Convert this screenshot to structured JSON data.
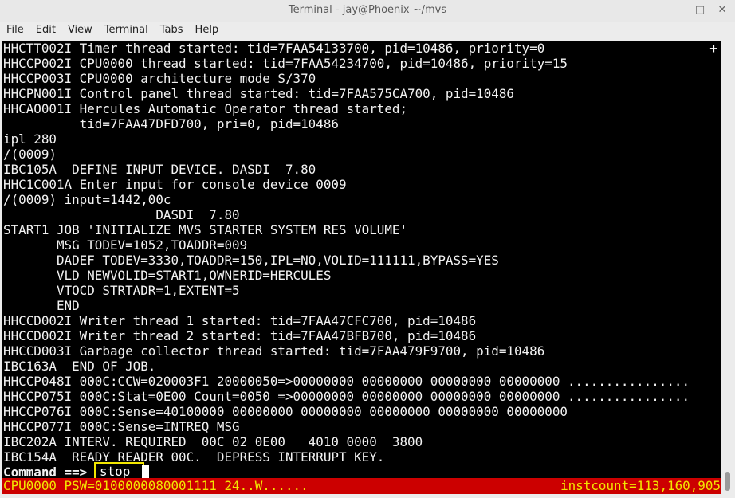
{
  "window": {
    "title": "Terminal - jay@Phoenix ~/mvs",
    "minimize_glyph": "–",
    "maximize_glyph": "□",
    "close_glyph": "✕"
  },
  "menubar": {
    "items": [
      "File",
      "Edit",
      "View",
      "Terminal",
      "Tabs",
      "Help"
    ]
  },
  "terminal": {
    "corner_marker": "+",
    "lines": [
      "HHCTT002I Timer thread started: tid=7FAA54133700, pid=10486, priority=0",
      "HHCCP002I CPU0000 thread started: tid=7FAA54234700, pid=10486, priority=15",
      "HHCCP003I CPU0000 architecture mode S/370",
      "HHCPN001I Control panel thread started: tid=7FAA575CA700, pid=10486",
      "HHCAO001I Hercules Automatic Operator thread started;",
      "          tid=7FAA47DFD700, pri=0, pid=10486",
      "ipl 280",
      "/(0009)",
      "IBC105A  DEFINE INPUT DEVICE. DASDI  7.80",
      "HHC1C001A Enter input for console device 0009",
      "/(0009) input=1442,00c",
      "                    DASDI  7.80",
      "START1 JOB 'INITIALIZE MVS STARTER SYSTEM RES VOLUME'",
      "       MSG TODEV=1052,TOADDR=009",
      "       DADEF TODEV=3330,TOADDR=150,IPL=NO,VOLID=111111,BYPASS=YES",
      "       VLD NEWVOLID=START1,OWNERID=HERCULES",
      "       VTOCD STRTADR=1,EXTENT=5",
      "       END",
      "HHCCD002I Writer thread 1 started: tid=7FAA47CFC700, pid=10486",
      "HHCCD002I Writer thread 2 started: tid=7FAA47BFB700, pid=10486",
      "HHCCD003I Garbage collector thread started: tid=7FAA479F9700, pid=10486",
      "IBC163A  END OF JOB.",
      "HHCCP048I 000C:CCW=020003F1 20000050=>00000000 00000000 00000000 00000000 ................",
      "HHCCP075I 000C:Stat=0E00 Count=0050 =>00000000 00000000 00000000 00000000 ................",
      "HHCCP076I 000C:Sense=40100000 00000000 00000000 00000000 00000000 00000000",
      "HHCCP077I 000C:Sense=INTREQ MSG",
      "IBC202A INTERV. REQUIRED  00C 02 0E00   4010 0000  3800",
      "IBC154A  READY READER 00C.  DEPRESS INTERRUPT KEY."
    ],
    "command_label": "Command ==>",
    "command_value": "stop",
    "status_left": "CPU0000 PSW=0100000080001111 24..W......",
    "status_right": "instcount=113,160,905"
  }
}
